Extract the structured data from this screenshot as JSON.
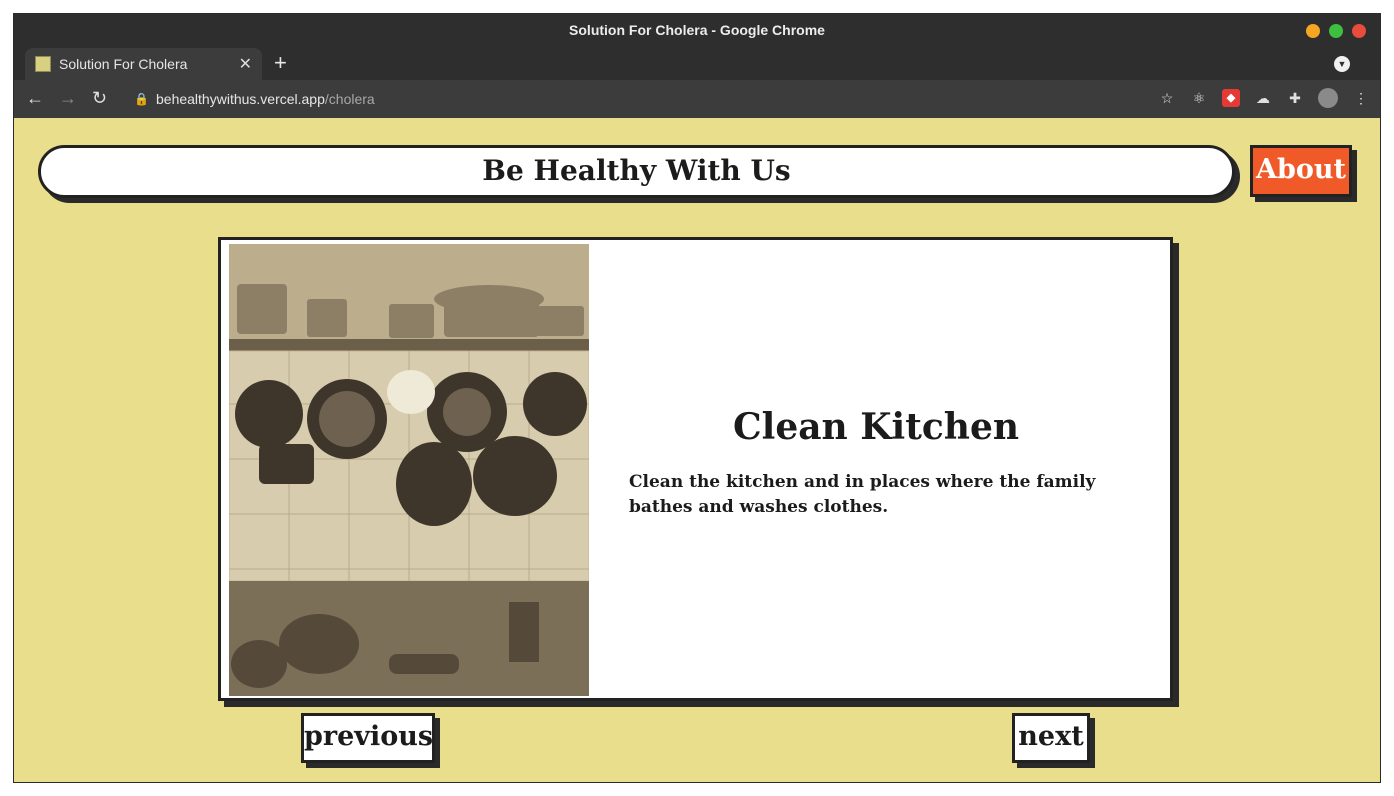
{
  "window": {
    "title": "Solution For Cholera - Google Chrome",
    "controls": {
      "minimize_color": "#f5a623",
      "maximize_color": "#3fbf3f",
      "close_color": "#e74c3c"
    }
  },
  "tab": {
    "title": "Solution For Cholera",
    "close_glyph": "✕",
    "new_tab_glyph": "+"
  },
  "toolbar": {
    "url_host": "behealthywithus.vercel.app",
    "url_path": "/cholera"
  },
  "page": {
    "header_title": "Be Healthy With Us",
    "about_label": "About",
    "card": {
      "title": "Clean Kitchen",
      "text": "Clean the kitchen and in places where the family bathes and washes clothes."
    },
    "previous_label": "previous",
    "next_label": "next"
  },
  "colors": {
    "page_bg": "#e8de8c",
    "accent": "#f05a28",
    "border": "#222222"
  }
}
